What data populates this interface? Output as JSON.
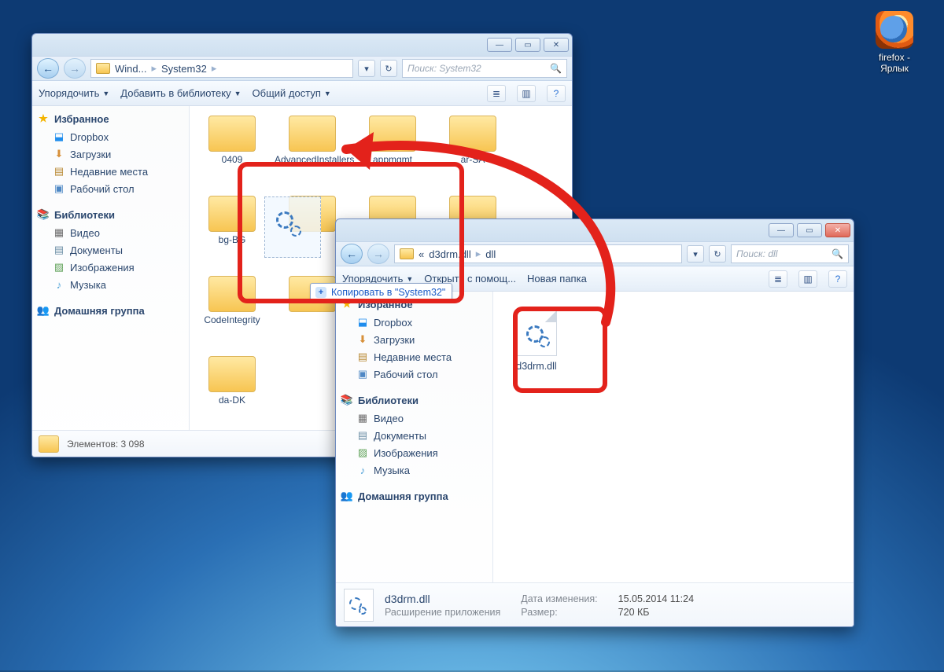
{
  "desktop": {
    "shortcut": {
      "label": "firefox - Ярлык"
    }
  },
  "win1": {
    "breadcrumbs": [
      "Wind...",
      "System32"
    ],
    "search_placeholder": "Поиск: System32",
    "toolbar": {
      "organize": "Упорядочить",
      "add_lib": "Добавить в библиотеку",
      "share": "Общий доступ"
    },
    "sidebar": {
      "favorites": "Избранное",
      "fav_items": [
        "Dropbox",
        "Загрузки",
        "Недавние места",
        "Рабочий стол"
      ],
      "libraries": "Библиотеки",
      "lib_items": [
        "Видео",
        "Документы",
        "Изображения",
        "Музыка"
      ],
      "homegroup": "Домашняя группа"
    },
    "folders": [
      "0409",
      "AdvancedInstallers",
      "appmgmt",
      "ar-SA",
      "bg-BG",
      "",
      "",
      "",
      "CodeIntegrity",
      "",
      "",
      "",
      "da-DK"
    ],
    "status": "Элементов: 3 098"
  },
  "win2": {
    "breadcrumbs_prefix": "«",
    "breadcrumbs": [
      "d3drm.dll",
      "dll"
    ],
    "search_placeholder": "Поиск: dll",
    "toolbar": {
      "organize": "Упорядочить",
      "open_with": "Открыть с помощ...",
      "new_folder": "Новая папка"
    },
    "sidebar": {
      "favorites": "Избранное",
      "fav_items": [
        "Dropbox",
        "Загрузки",
        "Недавние места",
        "Рабочий стол"
      ],
      "libraries": "Библиотеки",
      "lib_items": [
        "Видео",
        "Документы",
        "Изображения",
        "Музыка"
      ],
      "homegroup": "Домашняя группа"
    },
    "file": {
      "name": "d3drm.dll"
    },
    "details": {
      "name": "d3drm.dll",
      "type": "Расширение приложения",
      "date_label": "Дата изменения:",
      "date_value": "15.05.2014 11:24",
      "size_label": "Размер:",
      "size_value": "720 КБ"
    }
  },
  "drag": {
    "tooltip": "Копировать в \"System32\""
  }
}
